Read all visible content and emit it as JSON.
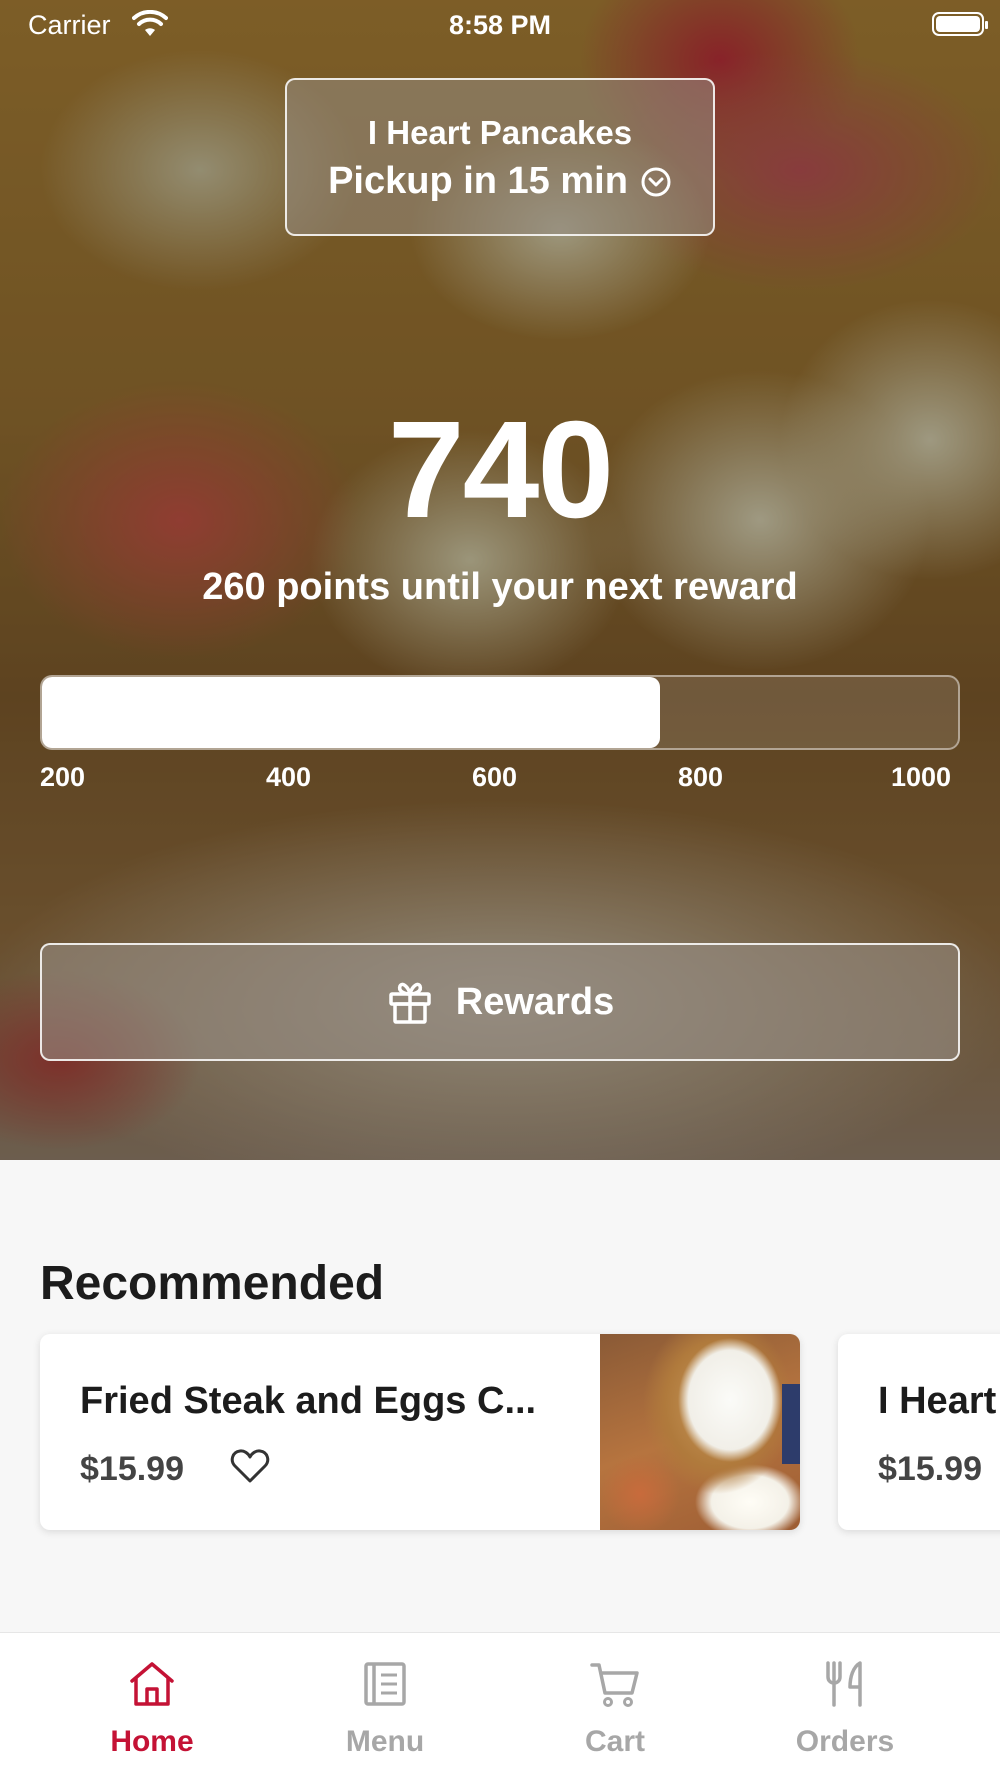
{
  "status_bar": {
    "carrier": "Carrier",
    "time": "8:58 PM"
  },
  "store": {
    "name": "I Heart Pancakes",
    "pickup": "Pickup in 15 min"
  },
  "points": {
    "value": "740",
    "caption": "260 points until your next reward",
    "progress": {
      "min": 200,
      "max": 1000,
      "current": 740
    },
    "ticks": [
      "200",
      "400",
      "600",
      "800",
      "1000"
    ]
  },
  "rewards_button": {
    "label": "Rewards",
    "icon": "gift-icon"
  },
  "recommended": {
    "title": "Recommended",
    "items": [
      {
        "name": "Fried Steak and Eggs C...",
        "price": "$15.99"
      },
      {
        "name": "I Heart",
        "price": "$15.99"
      }
    ]
  },
  "tabs": [
    {
      "label": "Home",
      "icon": "home-icon",
      "active": true
    },
    {
      "label": "Menu",
      "icon": "menu-icon",
      "active": false
    },
    {
      "label": "Cart",
      "icon": "cart-icon",
      "active": false
    },
    {
      "label": "Orders",
      "icon": "fork-knife-icon",
      "active": false
    }
  ],
  "colors": {
    "accent": "#c41235",
    "inactive_tab": "#a7a7a7"
  }
}
